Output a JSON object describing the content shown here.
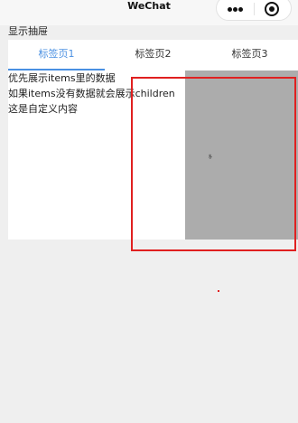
{
  "navbar": {
    "title": "WeChat",
    "icons": {
      "more": "more-dots-icon",
      "close": "target-circle-icon"
    }
  },
  "section_label": "显示抽屉",
  "tabs": [
    {
      "label": "标签页1",
      "active": true
    },
    {
      "label": "标签页2",
      "active": false
    },
    {
      "label": "标签页3",
      "active": false
    }
  ],
  "content": {
    "lines": [
      "优先展示items里的数据",
      "如果items没有数据就会展示children",
      "这是自定义内容"
    ],
    "drawer_mark": "ab"
  },
  "colors": {
    "accent": "#4a90e2",
    "highlight": "#e02020",
    "drawer": "#acacac",
    "background": "#efefef"
  }
}
